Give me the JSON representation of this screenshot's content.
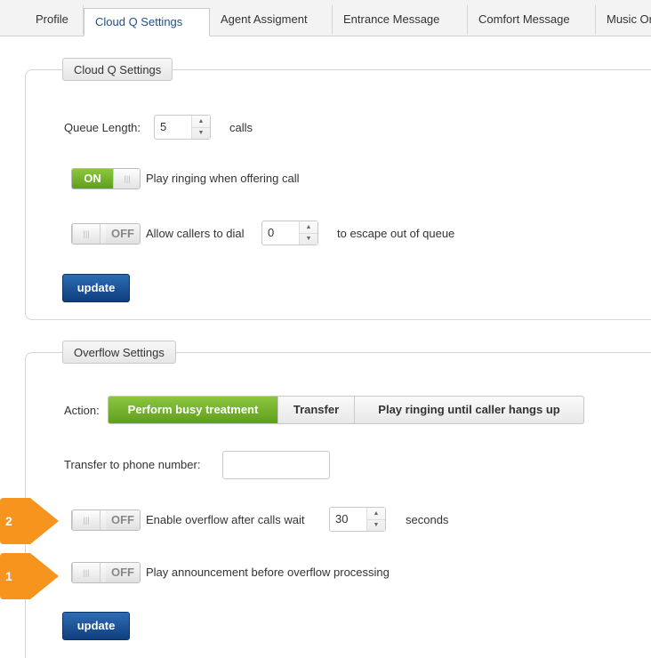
{
  "tabs": [
    {
      "label": "Profile"
    },
    {
      "label": "Cloud Q Settings"
    },
    {
      "label": "Agent Assigment"
    },
    {
      "label": "Entrance Message"
    },
    {
      "label": "Comfort Message"
    },
    {
      "label": "Music On Hold"
    }
  ],
  "cloudq": {
    "legend": "Cloud Q Settings",
    "queue_label": "Queue Length:",
    "queue_value": "5",
    "queue_unit": "calls",
    "ringing_toggle": {
      "state": "ON",
      "label": "Play ringing when offering call"
    },
    "dial_toggle": {
      "state": "OFF",
      "label": "Allow callers to dial"
    },
    "dial_value": "0",
    "dial_suffix": "to escape out of queue",
    "update_label": "update"
  },
  "overflow": {
    "legend": "Overflow Settings",
    "action_label": "Action:",
    "actions": [
      {
        "label": "Perform busy treatment",
        "selected": true
      },
      {
        "label": "Transfer",
        "selected": false
      },
      {
        "label": "Play ringing until caller hangs up",
        "selected": false
      }
    ],
    "transfer_label": "Transfer to phone number:",
    "transfer_value": "",
    "wait_toggle": {
      "state": "OFF",
      "label": "Enable overflow after calls wait"
    },
    "wait_value": "30",
    "wait_unit": "seconds",
    "announce_toggle": {
      "state": "OFF",
      "label": "Play announcement before overflow processing"
    },
    "update_label": "update"
  },
  "markers": [
    {
      "number": "2",
      "color": "#f7941d"
    },
    {
      "number": "1",
      "color": "#f7941d"
    }
  ],
  "colors": {
    "toggle_on": "#6aad24",
    "update_button": "#1b4f8f",
    "segment_selected": "#6aad24",
    "marker": "#f7941d"
  }
}
